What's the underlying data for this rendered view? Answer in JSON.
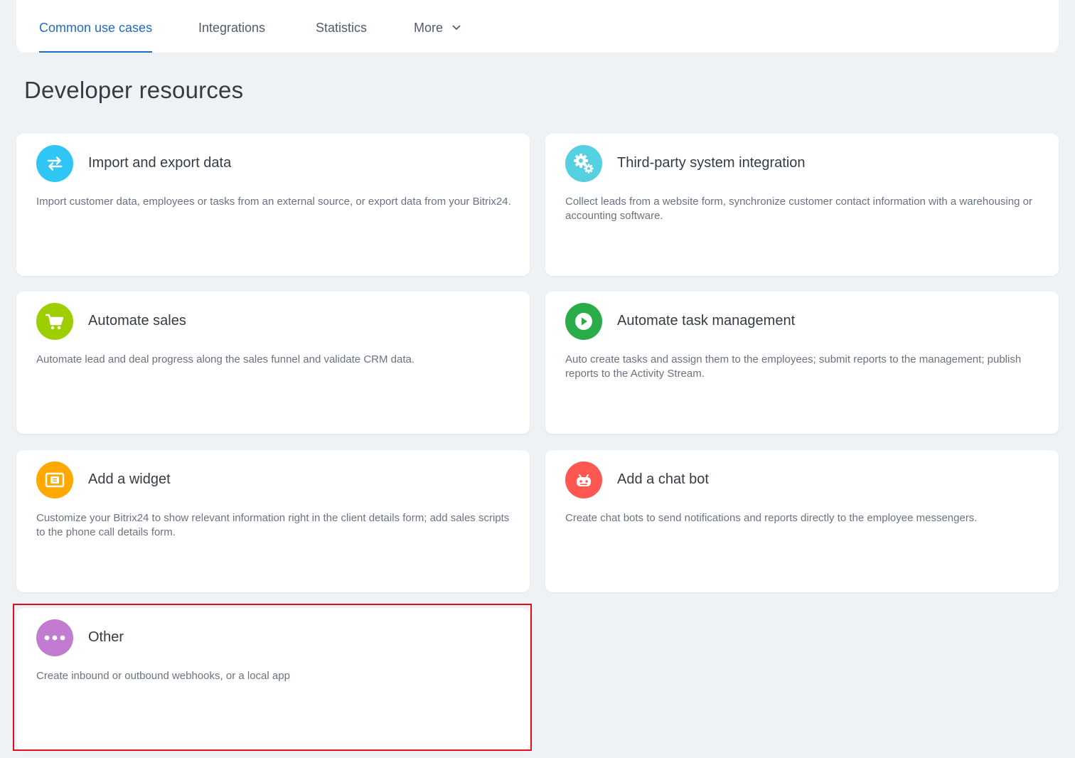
{
  "nav": {
    "tabs": [
      {
        "label": "Common use cases",
        "active": true
      },
      {
        "label": "Integrations",
        "active": false
      },
      {
        "label": "Statistics",
        "active": false
      },
      {
        "label": "More",
        "active": false
      }
    ]
  },
  "page": {
    "title": "Developer resources"
  },
  "cards": [
    {
      "title": "Import and export data",
      "description": "Import customer data, employees or tasks from an external source, or export data from your Bitrix24.",
      "icon": "arrows-swap-icon",
      "color": "#2fc6f6"
    },
    {
      "title": "Third-party system integration",
      "description": "Collect leads from a website form, synchronize customer contact information with a warehousing or accounting software.",
      "icon": "gears-icon",
      "color": "#55d0e0"
    },
    {
      "title": "Automate sales",
      "description": "Automate lead and deal progress along the sales funnel and validate CRM data.",
      "icon": "shopping-cart-icon",
      "color": "#9dcf00"
    },
    {
      "title": "Automate task management",
      "description": "Auto create tasks and assign them to the employees; submit reports to the management; publish reports to the Activity Stream.",
      "icon": "play-icon",
      "color": "#29ad49"
    },
    {
      "title": "Add a widget",
      "description": "Customize your Bitrix24 to show relevant information right in the client details form; add sales scripts to the phone call details form.",
      "icon": "widget-icon",
      "color": "#ffa900"
    },
    {
      "title": "Add a chat bot",
      "description": "Create chat bots to send notifications and reports directly to the employee messengers.",
      "icon": "robot-icon",
      "color": "#ff5752"
    },
    {
      "title": "Other",
      "description": "Create inbound or outbound webhooks, or a local app",
      "icon": "more-dots-icon",
      "color": "#c17bd1"
    }
  ],
  "highlight": {
    "color": "#e0101e"
  }
}
